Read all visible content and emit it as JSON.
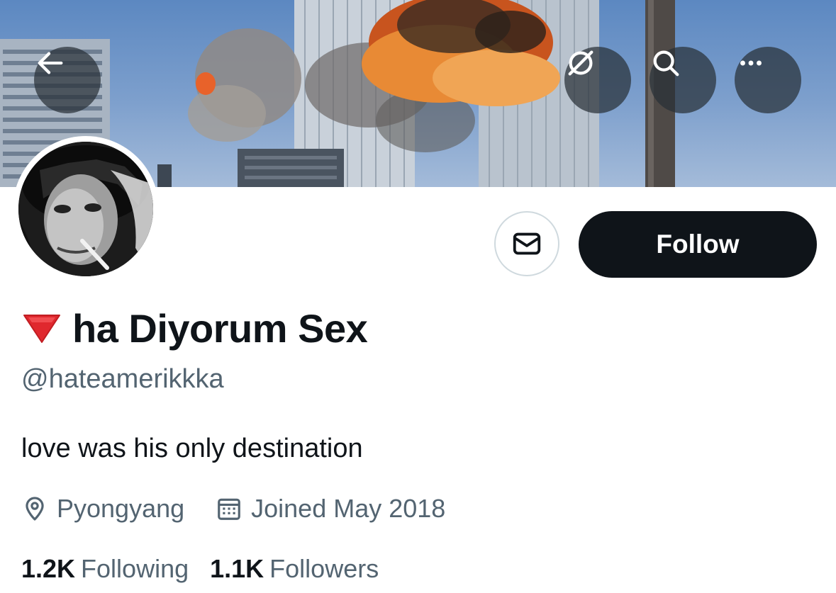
{
  "profile": {
    "display_name": "ha Diyorum Sex",
    "handle": "@hateamerikkka",
    "bio": "love was his only destination",
    "location": "Pyongyang",
    "joined": "Joined May 2018",
    "following_count": "1.2K",
    "following_label": "Following",
    "followers_count": "1.1K",
    "followers_label": "Followers"
  },
  "actions": {
    "follow_label": "Follow"
  },
  "icons": {
    "back": "back-arrow-icon",
    "translate": "no-translate-icon",
    "search": "search-icon",
    "more": "more-icon",
    "message": "envelope-icon",
    "location": "location-pin-icon",
    "calendar": "calendar-icon",
    "name_emoji": "red-triangle-down-icon"
  },
  "colors": {
    "follow_bg": "#0f1419",
    "secondary_text": "#536471",
    "header_button_bg": "#283038",
    "emoji_red": "#e0282e"
  }
}
